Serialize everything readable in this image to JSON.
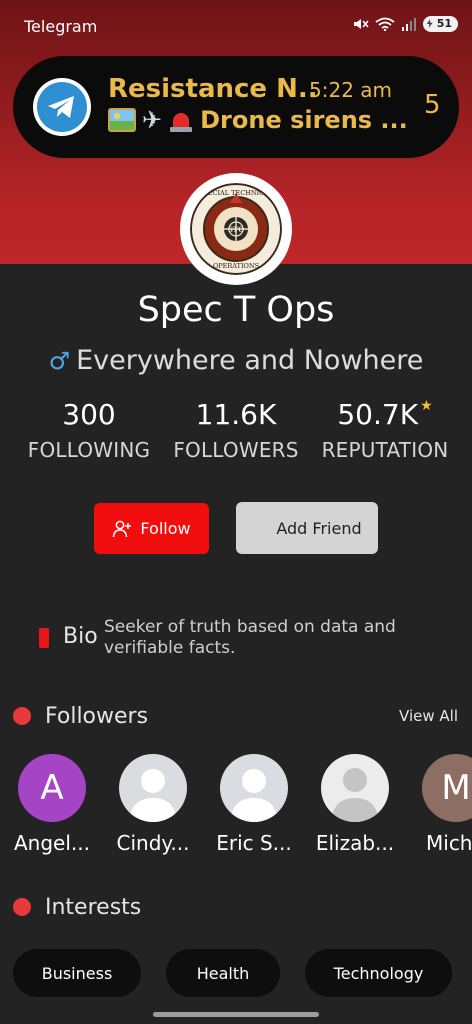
{
  "status_bar": {
    "app_name": "Telegram",
    "battery": "51",
    "icons": [
      "mute-icon",
      "wifi-icon",
      "signal-icon",
      "battery-icon"
    ]
  },
  "notification": {
    "app_icon": "telegram-icon",
    "title": "Resistance N..",
    "time": "5:22 am",
    "body_emojis": [
      "picture-emoji",
      "airplane-emoji",
      "siren-emoji"
    ],
    "body_text": "Drone sirens ...",
    "count": "5",
    "accent_color": "#e9b94a"
  },
  "profile": {
    "avatar_text": "SPECIAL TECHNICAL OPERATIONS",
    "avatar_initials": "STO",
    "name": "Spec T Ops",
    "gender_icon": "male-icon",
    "location": "Everywhere and Nowhere"
  },
  "stats": [
    {
      "value": "300",
      "label": "FOLLOWING"
    },
    {
      "value": "11.6K",
      "label": "FOLLOWERS"
    },
    {
      "value": "50.7K",
      "label": "REPUTATION"
    }
  ],
  "actions": {
    "follow_label": "Follow",
    "add_friend_label": "Add Friend",
    "follow_color": "#f20e0e"
  },
  "bio": {
    "label": "Bio",
    "text": "Seeker of truth based on data and verifiable facts."
  },
  "followers_section": {
    "title": "Followers",
    "view_all": "View All",
    "items": [
      {
        "name": "Angel...",
        "initial": "A",
        "color": "#a544c4"
      },
      {
        "name": "Cindy...",
        "initial": "",
        "color": "#d9dde2"
      },
      {
        "name": "Eric S...",
        "initial": "",
        "color": "#d9dde2"
      },
      {
        "name": "Elizab...",
        "initial": "",
        "color": "#ececec"
      },
      {
        "name": "Mich",
        "initial": "M",
        "color": "#8d6e63"
      }
    ]
  },
  "interests_section": {
    "title": "Interests",
    "chips": [
      "Business",
      "Health",
      "Technology"
    ]
  }
}
